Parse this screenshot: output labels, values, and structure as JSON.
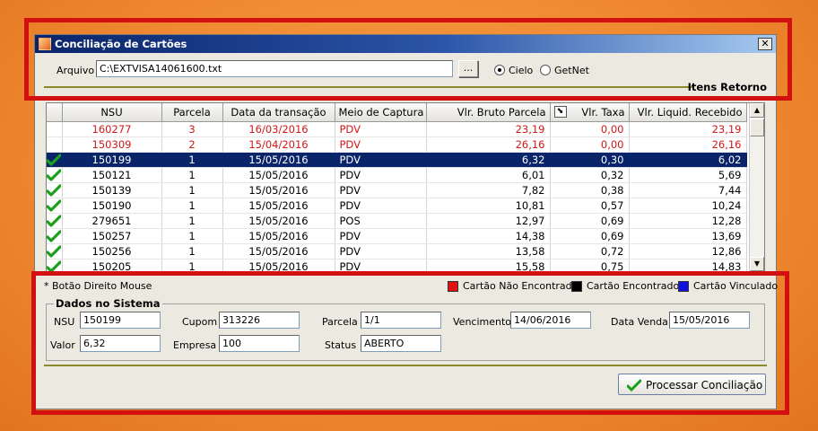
{
  "window": {
    "title": "Conciliação de Cartões",
    "close_glyph": "✕"
  },
  "file": {
    "label": "Arquivo",
    "value": "C:\\EXTVISA14061600.txt",
    "browse_label": "...",
    "radios": [
      {
        "label": "Cielo",
        "selected": true
      },
      {
        "label": "GetNet",
        "selected": false
      }
    ]
  },
  "section_title": "Itens Retorno",
  "grid": {
    "columns": [
      {
        "label": ""
      },
      {
        "label": "NSU"
      },
      {
        "label": "Parcela"
      },
      {
        "label": "Data da transação"
      },
      {
        "label": "Meio de Captura"
      },
      {
        "label": "Vlr. Bruto Parcela"
      },
      {
        "label": "Vlr. Taxa",
        "icon": "sort-icon"
      },
      {
        "label": "Vlr. Liquid. Recebido"
      }
    ],
    "rows": [
      {
        "status": "red",
        "nsu": "160277",
        "parcela": "3",
        "data": "16/03/2016",
        "meio": "PDV",
        "bruto": "23,19",
        "taxa": "0,00",
        "liquido": "23,19"
      },
      {
        "status": "red",
        "nsu": "150309",
        "parcela": "2",
        "data": "15/04/2016",
        "meio": "PDV",
        "bruto": "26,16",
        "taxa": "0,00",
        "liquido": "26,16"
      },
      {
        "status": "sel",
        "nsu": "150199",
        "parcela": "1",
        "data": "15/05/2016",
        "meio": "PDV",
        "bruto": "6,32",
        "taxa": "0,30",
        "liquido": "6,02"
      },
      {
        "status": "ok",
        "nsu": "150121",
        "parcela": "1",
        "data": "15/05/2016",
        "meio": "PDV",
        "bruto": "6,01",
        "taxa": "0,32",
        "liquido": "5,69"
      },
      {
        "status": "ok",
        "nsu": "150139",
        "parcela": "1",
        "data": "15/05/2016",
        "meio": "PDV",
        "bruto": "7,82",
        "taxa": "0,38",
        "liquido": "7,44"
      },
      {
        "status": "ok",
        "nsu": "150190",
        "parcela": "1",
        "data": "15/05/2016",
        "meio": "PDV",
        "bruto": "10,81",
        "taxa": "0,57",
        "liquido": "10,24"
      },
      {
        "status": "ok",
        "nsu": "279651",
        "parcela": "1",
        "data": "15/05/2016",
        "meio": "POS",
        "bruto": "12,97",
        "taxa": "0,69",
        "liquido": "12,28"
      },
      {
        "status": "ok",
        "nsu": "150257",
        "parcela": "1",
        "data": "15/05/2016",
        "meio": "PDV",
        "bruto": "14,38",
        "taxa": "0,69",
        "liquido": "13,69"
      },
      {
        "status": "ok",
        "nsu": "150256",
        "parcela": "1",
        "data": "15/05/2016",
        "meio": "PDV",
        "bruto": "13,58",
        "taxa": "0,72",
        "liquido": "12,86"
      },
      {
        "status": "ok",
        "nsu": "150205",
        "parcela": "1",
        "data": "15/05/2016",
        "meio": "PDV",
        "bruto": "15,58",
        "taxa": "0,75",
        "liquido": "14,83"
      }
    ]
  },
  "hint": "* Botão Direito Mouse",
  "legend": [
    {
      "label": "Cartão Não Encontrado",
      "color": "#e01010"
    },
    {
      "label": "Cartão Encontrado",
      "color": "#000000"
    },
    {
      "label": "Cartão Vinculado",
      "color": "#1010e0"
    }
  ],
  "dados": {
    "title": "Dados no Sistema",
    "nsu_label": "NSU",
    "nsu": "150199",
    "cupom_label": "Cupom",
    "cupom": "313226",
    "parcela_label": "Parcela",
    "parcela": "1/1",
    "vencimento_label": "Vencimento",
    "vencimento": "14/06/2016",
    "data_venda_label": "Data Venda",
    "data_venda": "15/05/2016",
    "valor_label": "Valor",
    "valor": "6,32",
    "empresa_label": "Empresa",
    "empresa": "100",
    "status_label": "Status",
    "status": "ABERTO"
  },
  "process_button": "Processar Conciliação",
  "colors": {
    "highlight": "#d21010",
    "selected_row": "#0a246a",
    "not_found_text": "#d01818",
    "check_green": "#1aa01a"
  }
}
